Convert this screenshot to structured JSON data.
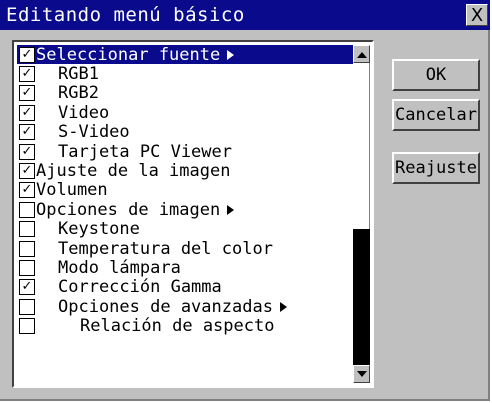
{
  "window": {
    "title": "Editando menú básico",
    "close_glyph": "X"
  },
  "colors": {
    "title_bar": "#0a0a8c",
    "selection": "#0a0a8c",
    "face": "#c0c0c0"
  },
  "menu_items": [
    {
      "label": "Seleccionar fuente",
      "checked": true,
      "level": 0,
      "submenu": true,
      "selected": true
    },
    {
      "label": "RGB1",
      "checked": true,
      "level": 1,
      "submenu": false,
      "selected": false
    },
    {
      "label": "RGB2",
      "checked": true,
      "level": 1,
      "submenu": false,
      "selected": false
    },
    {
      "label": "Video",
      "checked": true,
      "level": 1,
      "submenu": false,
      "selected": false
    },
    {
      "label": "S-Video",
      "checked": true,
      "level": 1,
      "submenu": false,
      "selected": false
    },
    {
      "label": "Tarjeta PC Viewer",
      "checked": true,
      "level": 1,
      "submenu": false,
      "selected": false
    },
    {
      "label": "Ajuste de la imagen",
      "checked": true,
      "level": 0,
      "submenu": false,
      "selected": false
    },
    {
      "label": "Volumen",
      "checked": true,
      "level": 0,
      "submenu": false,
      "selected": false
    },
    {
      "label": "Opciones de imagen",
      "checked": false,
      "level": 0,
      "submenu": true,
      "selected": false
    },
    {
      "label": "Keystone",
      "checked": false,
      "level": 1,
      "submenu": false,
      "selected": false
    },
    {
      "label": "Temperatura del color",
      "checked": false,
      "level": 1,
      "submenu": false,
      "selected": false
    },
    {
      "label": "Modo lámpara",
      "checked": false,
      "level": 1,
      "submenu": false,
      "selected": false
    },
    {
      "label": "Corrección Gamma",
      "checked": true,
      "level": 1,
      "submenu": false,
      "selected": false
    },
    {
      "label": "Opciones de avanzadas",
      "checked": false,
      "level": 1,
      "submenu": true,
      "selected": false
    },
    {
      "label": "Relación de aspecto",
      "checked": false,
      "level": 2,
      "submenu": false,
      "selected": false
    }
  ],
  "buttons": {
    "ok": "OK",
    "cancel": "Cancelar",
    "reset": "Reajuste"
  }
}
